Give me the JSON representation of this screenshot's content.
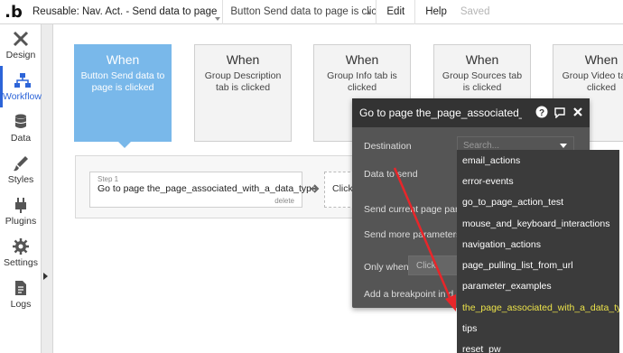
{
  "topbar": {
    "logo": ".b",
    "page_name": "Reusable: Nav. Act. - Send data to page",
    "workflow_name": "Button Send data to page is click...",
    "menu": {
      "edit": "Edit",
      "help": "Help",
      "saved": "Saved"
    }
  },
  "sidebar": {
    "items": [
      {
        "label": "Design",
        "icon": "design-icon"
      },
      {
        "label": "Workflow",
        "icon": "workflow-icon"
      },
      {
        "label": "Data",
        "icon": "data-icon"
      },
      {
        "label": "Styles",
        "icon": "styles-icon"
      },
      {
        "label": "Plugins",
        "icon": "plugins-icon"
      },
      {
        "label": "Settings",
        "icon": "settings-icon"
      },
      {
        "label": "Logs",
        "icon": "logs-icon"
      }
    ],
    "active": "Workflow"
  },
  "events": [
    {
      "when": "When",
      "desc": "Button Send data to page is clicked"
    },
    {
      "when": "When",
      "desc": "Group Description tab is clicked"
    },
    {
      "when": "When",
      "desc": "Group Info tab is clicked"
    },
    {
      "when": "When",
      "desc": "Group Sources tab is clicked"
    },
    {
      "when": "When",
      "desc": "Group Video tab is clicked"
    }
  ],
  "step": {
    "label": "Step 1",
    "text": "Go to page the_page_associated_with_a_data_type",
    "delete": "delete",
    "next_placeholder": "Click"
  },
  "panel": {
    "title": "Go to page the_page_associated_",
    "destination_label": "Destination",
    "data_to_send_label": "Data to send",
    "send_current_label": "Send current page para",
    "send_more_label": "Send more parameters",
    "only_when_label": "Only when",
    "only_when_value": "Click",
    "breakpoint_label": "Add a breakpoint in d"
  },
  "destination_dropdown": {
    "placeholder": "Search...",
    "options": [
      "email_actions",
      "error-events",
      "go_to_page_action_test",
      "mouse_and_keyboard_interactions",
      "navigation_actions",
      "page_pulling_list_from_url",
      "parameter_examples",
      "the_page_associated_with_a_data_type",
      "tips",
      "reset_pw"
    ],
    "highlighted": "the_page_associated_with_a_data_type"
  },
  "colors": {
    "accent": "#2c64d8",
    "active_event": "#79b8ea",
    "panel": "#555555",
    "highlight": "#ece34a",
    "annotation_arrow": "#e8262a"
  }
}
